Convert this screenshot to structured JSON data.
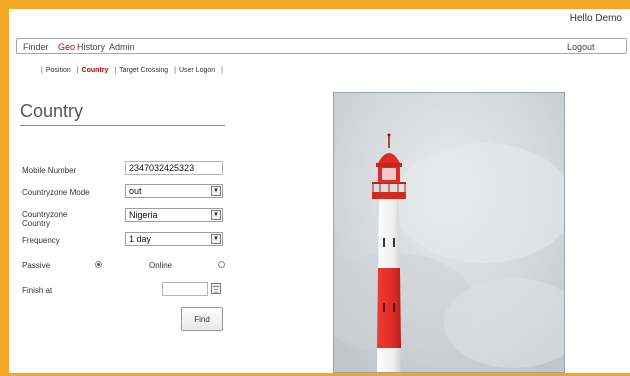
{
  "header": {
    "greeting": "Hello Demo"
  },
  "menu": {
    "items": [
      {
        "label": "Finder",
        "active": false
      },
      {
        "label": "Geo",
        "active": true
      },
      {
        "label": "History",
        "active": false
      },
      {
        "label": "Admin",
        "active": false
      }
    ],
    "logout": "Logout"
  },
  "submenu": {
    "items": [
      {
        "label": "Position",
        "active": false
      },
      {
        "label": "Country",
        "active": true
      },
      {
        "label": "Target Crossing",
        "active": false
      },
      {
        "label": "User Logon",
        "active": false
      }
    ]
  },
  "page": {
    "title": "Country"
  },
  "form": {
    "mobile_number": {
      "label": "Mobile Number",
      "value": "2347032425323"
    },
    "countryzone_mode": {
      "label": "Countryzone Mode",
      "value": "out"
    },
    "countryzone_country": {
      "label_line1": "Countryzone",
      "label_line2": "Country",
      "value": "Nigeria"
    },
    "frequency": {
      "label": "Frequency",
      "value": "1 day"
    },
    "passive": {
      "label": "Passive",
      "checked": true
    },
    "online": {
      "label": "Online",
      "checked": false
    },
    "finish_at": {
      "label": "Finish at",
      "value": ""
    },
    "find_button": "Find"
  },
  "colors": {
    "frame": "#f4a622",
    "active_link": "#c00000",
    "lighthouse_red": "#e12a26",
    "lighthouse_white": "#f7f7f7"
  }
}
